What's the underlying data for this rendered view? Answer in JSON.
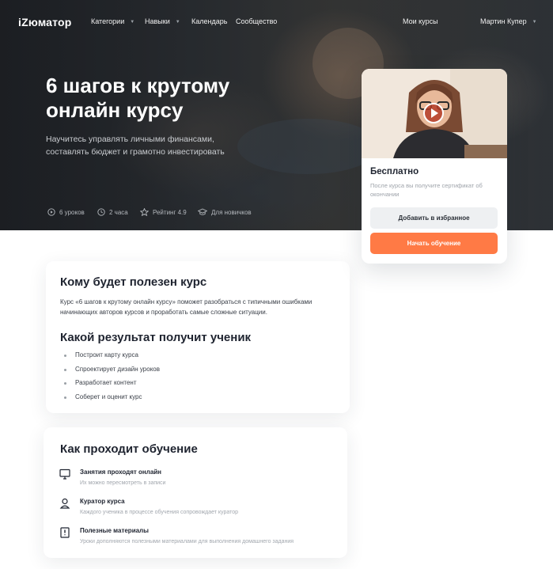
{
  "nav": {
    "logo": "iZюматор",
    "items": [
      {
        "label": "Категории",
        "has_caret": true
      },
      {
        "label": "Навыки",
        "has_caret": true
      },
      {
        "label": "Календарь",
        "has_caret": false
      },
      {
        "label": "Сообщество",
        "has_caret": false
      }
    ],
    "my_courses": "Мои курсы",
    "user_name": "Мартин Купер"
  },
  "hero": {
    "title": "6 шагов к крутому онлайн курсу",
    "subtitle": "Научитесь управлять личными финансами, составлять бюджет и грамотно инвестировать",
    "meta": [
      {
        "icon": "play-circle-icon",
        "text": "6 уроков"
      },
      {
        "icon": "clock-icon",
        "text": "2 часа"
      },
      {
        "icon": "star-icon",
        "text": "Рейтинг 4.9"
      },
      {
        "icon": "graduation-cap-icon",
        "text": "Для новичков"
      }
    ]
  },
  "card": {
    "price": "Бесплатно",
    "note": "После курса вы получите сертификат об окончании",
    "favorite_label": "Добавить в избранное",
    "start_label": "Начать обучение",
    "accent_color": "#ff7a45"
  },
  "audience": {
    "title": "Кому будет полезен курс",
    "text": "Курс «6 шагов к крутому онлайн курсу» поможет разобраться с типичными ошибками начинающих авторов курсов и проработать самые сложные ситуации."
  },
  "result": {
    "title": "Какой результат получит ученик",
    "items": [
      "Построит карту курса",
      "Спроектирует дизайн уроков",
      "Разработает контент",
      "Соберет и оценит курс"
    ]
  },
  "learning": {
    "title": "Как проходит обучение",
    "features": [
      {
        "icon": "monitor-icon",
        "title": "Занятия проходят онлайн",
        "desc": "Их можно пересмотреть в записи"
      },
      {
        "icon": "curator-icon",
        "title": "Куратор курса",
        "desc": "Каждого ученика в процессе обучения сопровождает куратор"
      },
      {
        "icon": "document-icon",
        "title": "Полезные материалы",
        "desc": "Уроки дополняются полезными материалами для выполнения домашнего задания"
      }
    ]
  }
}
